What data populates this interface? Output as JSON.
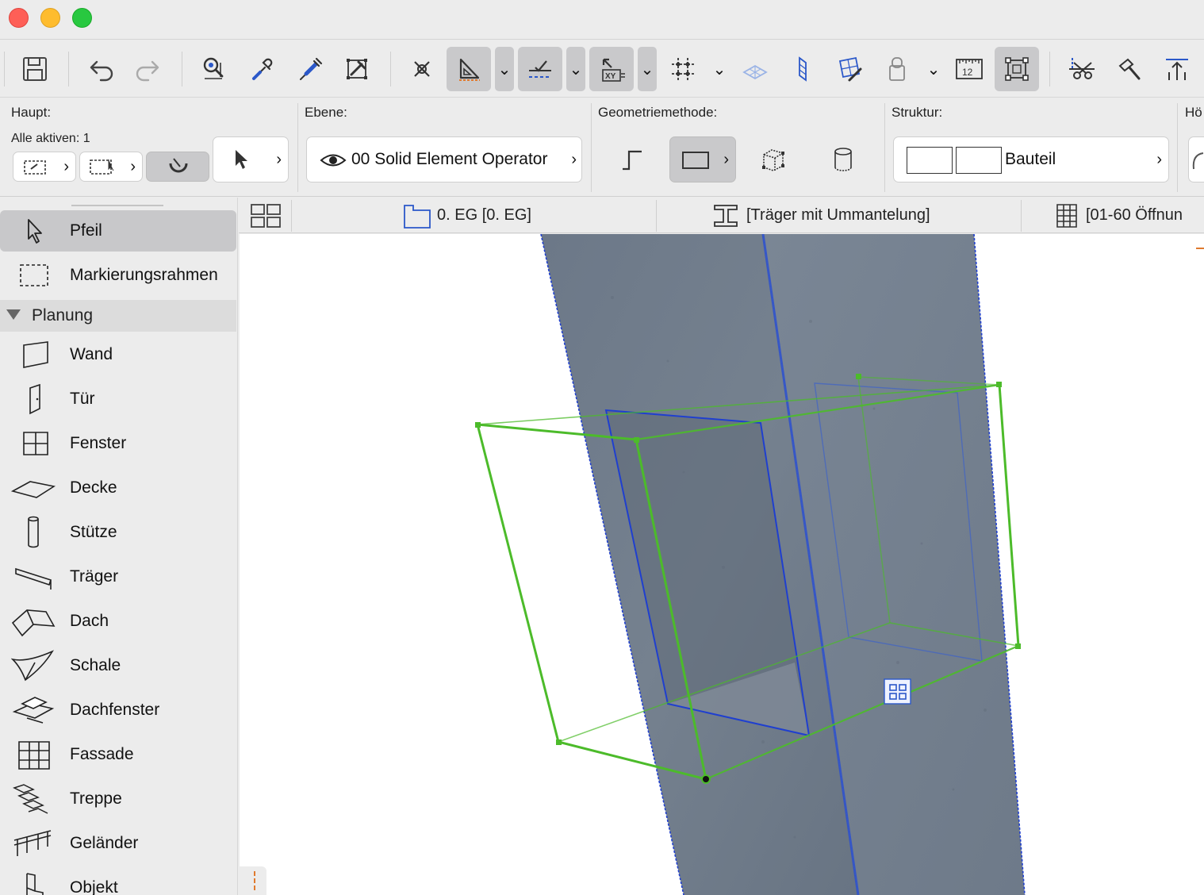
{
  "toolbar": {
    "icons": [
      "save-icon",
      "undo-icon",
      "redo-icon",
      "find-select-icon",
      "eyedropper-icon",
      "syringe-icon",
      "parameter-transfer-icon",
      "intersection-snap-icon",
      "guide-lines-icon",
      "snap-guides-icon",
      "coordinates-icon",
      "grid-snap-icon",
      "plane-icon",
      "vertical-plane-icon",
      "trace-icon",
      "renovation-icon",
      "measure-icon",
      "edit-selection-icon",
      "split-icon",
      "adjust-icon",
      "elevation-icon"
    ],
    "dimension_icon_text": "12",
    "coords_icon_text": "XY"
  },
  "info_box": {
    "haupt_label": "Haupt:",
    "alle_aktiven": "Alle aktiven: 1",
    "ebene_label": "Ebene:",
    "ebene_value": "00 Solid Element Operator",
    "geometrie_label": "Geometriemethode:",
    "struktur_label": "Struktur:",
    "struktur_value": "Bauteil",
    "hoehe_label": "Hö"
  },
  "sidebar": {
    "items_top": [
      {
        "label": "Pfeil",
        "icon": "arrow-pointer-icon",
        "selected": true
      },
      {
        "label": "Markierungsrahmen",
        "icon": "marquee-icon",
        "selected": false
      }
    ],
    "group": "Planung",
    "items": [
      {
        "label": "Wand",
        "icon": "wall-icon"
      },
      {
        "label": "Tür",
        "icon": "door-icon"
      },
      {
        "label": "Fenster",
        "icon": "window-icon"
      },
      {
        "label": "Decke",
        "icon": "slab-icon"
      },
      {
        "label": "Stütze",
        "icon": "column-icon"
      },
      {
        "label": "Träger",
        "icon": "beam-icon"
      },
      {
        "label": "Dach",
        "icon": "roof-icon"
      },
      {
        "label": "Schale",
        "icon": "shell-icon"
      },
      {
        "label": "Dachfenster",
        "icon": "skylight-icon"
      },
      {
        "label": "Fassade",
        "icon": "curtain-wall-icon"
      },
      {
        "label": "Treppe",
        "icon": "stair-icon"
      },
      {
        "label": "Geländer",
        "icon": "railing-icon"
      },
      {
        "label": "Objekt",
        "icon": "object-icon"
      }
    ]
  },
  "tabs": {
    "tab1": "0. EG [0. EG]",
    "tab2": "[Träger mit Ummantelung]",
    "tab3": "[01-60 Öffnun"
  },
  "colors": {
    "selection_green": "#4cbb2a",
    "selection_blue": "#1f3fcf",
    "concrete": "#6e7a88",
    "active_button": "#c9c9cb"
  }
}
